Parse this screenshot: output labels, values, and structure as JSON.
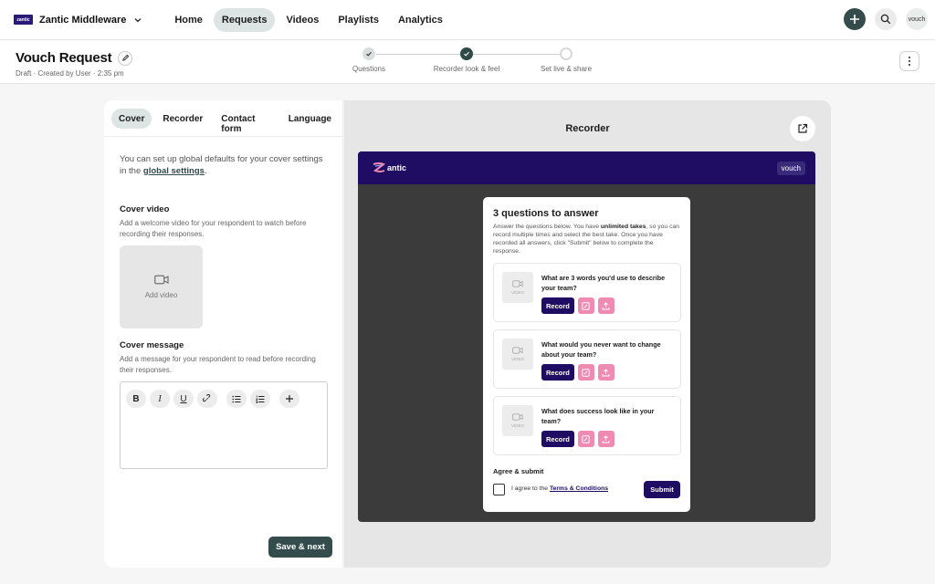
{
  "nav": {
    "org_logo_text": "zantic",
    "org_name": "Zantic Middleware",
    "links": [
      "Home",
      "Requests",
      "Videos",
      "Playlists",
      "Analytics"
    ],
    "active_link": "Requests",
    "user_label": "vouch"
  },
  "header": {
    "title": "Vouch Request",
    "subtitle": "Draft · Created by User · 2:35 pm",
    "steps": [
      {
        "label": "Questions",
        "status": "done"
      },
      {
        "label": "Recorder look & feel",
        "status": "current"
      },
      {
        "label": "Set live & share",
        "status": "todo"
      }
    ]
  },
  "left": {
    "tabs": [
      "Cover",
      "Recorder",
      "Contact form",
      "Language"
    ],
    "active_tab": "Cover",
    "intro_prefix": "You can set up global defaults for your cover settings in the ",
    "intro_link": "global settings",
    "intro_suffix": ".",
    "cover_video_title": "Cover video",
    "cover_video_desc": "Add a welcome video for your respondent to watch before recording their responses.",
    "add_video_label": "Add video",
    "cover_message_title": "Cover message",
    "cover_message_desc": "Add a message for your respondent to read before recording their responses.",
    "save_label": "Save & next"
  },
  "right": {
    "title": "Recorder",
    "preview": {
      "brand": "antic",
      "badge": "vouch",
      "card_title": "3 questions to answer",
      "desc_1": "Answer the questions below. You have ",
      "desc_bold": "unlimited takes",
      "desc_2": ", so you can record multiple times and select the best take. Once you have recorded all answers, click \"Submit\" below to complete the response.",
      "video_label": "VIDEO",
      "record_label": "Record",
      "questions": [
        "What are 3 words you'd use to describe your team?",
        "What would you never want to change about your team?",
        "What does success look like in your team?"
      ],
      "agree_title": "Agree & submit",
      "agree_prefix": "I agree to the ",
      "terms_label": "Terms & Conditions",
      "submit_label": "Submit"
    }
  },
  "colors": {
    "brand_dark": "#1f0c63",
    "accent_teal": "#344d4c",
    "pink": "#ef8bb2",
    "tab_active": "#dde5e4"
  }
}
